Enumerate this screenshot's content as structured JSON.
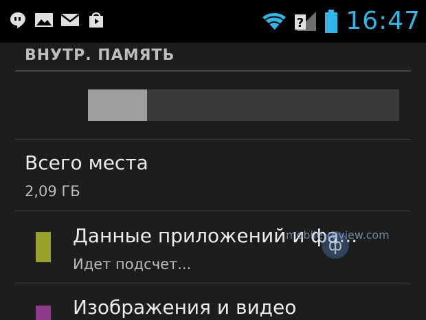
{
  "status_bar": {
    "notification_icons": [
      "hangouts-icon",
      "gallery-icon",
      "gmail-icon",
      "shopping-bag-icon"
    ],
    "system_icons": [
      "wifi-icon",
      "no-sim-icon",
      "battery-icon"
    ],
    "time": "16:47",
    "clock_color": "#33b5e5"
  },
  "storage": {
    "section_title": "ВНУТР. ПАМЯТЬ",
    "used_fraction": 0.19,
    "total": {
      "title": "Всего места",
      "value": "2,09 ГБ"
    },
    "items": [
      {
        "title": "Данные приложений и фа...",
        "subtitle": "Идет подсчет...",
        "color": "#98a12a"
      },
      {
        "title": "Изображения и видео",
        "subtitle": "",
        "color": "#8d3a8d"
      }
    ]
  },
  "watermark": {
    "text": "mobile-review.com"
  }
}
